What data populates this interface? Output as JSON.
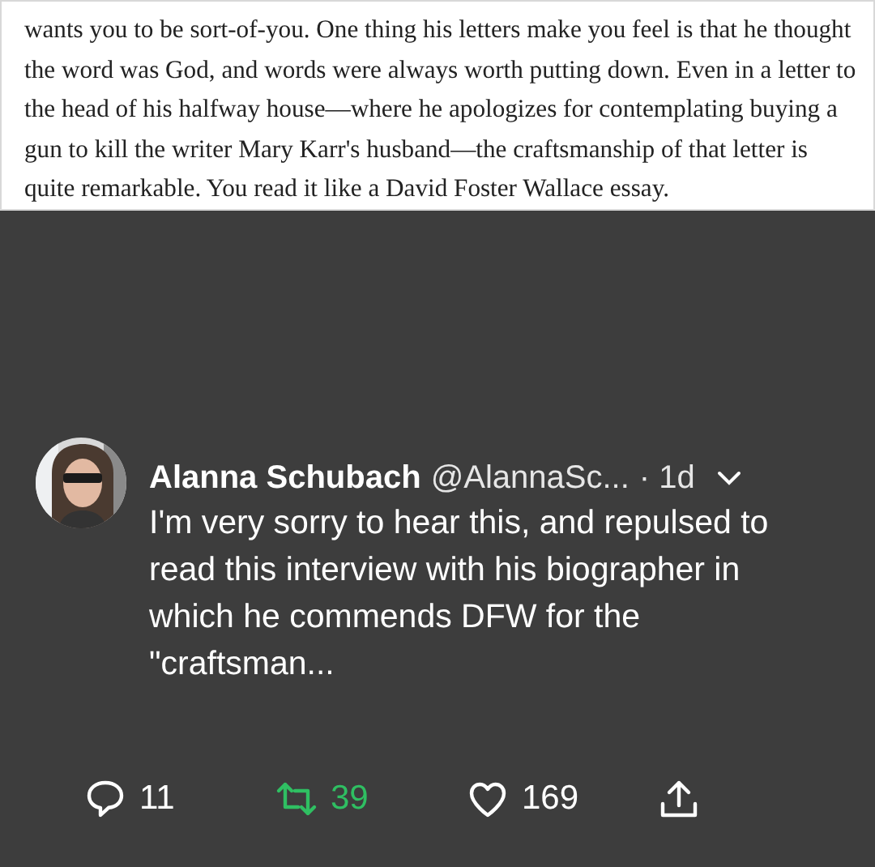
{
  "excerpt": "wants you to be sort-of-you. One thing his letters make you feel is that he thought the word was God, and words were always worth putting down. Even in a letter to the head of his halfway house—where he apologizes for contemplating buying a gun to kill the writer Mary Karr's husband—the craftsmanship of that letter is quite remarkable. You read it like a David Foster Wallace essay.",
  "tweet": {
    "name": "Alanna Schubach",
    "handle": "@AlannaSc...",
    "time": "· 1d",
    "text": "I'm very sorry to hear this, and repulsed to read this interview with his biographer in which he commends DFW for the \"craftsman...",
    "actions": [
      {
        "kind": "reply",
        "count": "11",
        "active": false
      },
      {
        "kind": "retweet",
        "count": "39",
        "active": true
      },
      {
        "kind": "like",
        "count": "169",
        "active": false
      },
      {
        "kind": "share",
        "active": false
      }
    ]
  }
}
